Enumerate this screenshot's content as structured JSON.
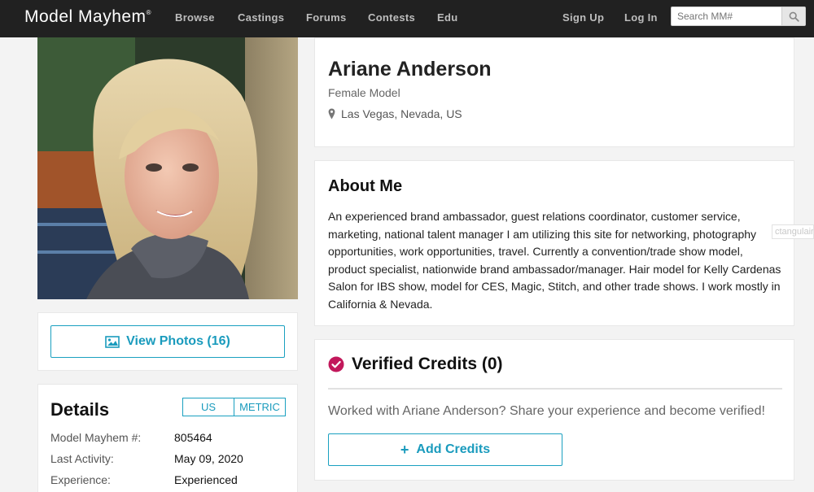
{
  "brand": {
    "logo": "Model Mayhem",
    "logo_mark": "®",
    "accent": "#1a9bbd",
    "nav_bg": "#212121",
    "verified_color": "#c2185b"
  },
  "nav": {
    "links": [
      "Browse",
      "Castings",
      "Forums",
      "Contests",
      "Edu"
    ],
    "sign_up": "Sign Up",
    "log_in": "Log In",
    "search_placeholder": "Search MM#",
    "search_icon": "search-icon"
  },
  "profile": {
    "name": "Ariane Anderson",
    "role": "Female Model",
    "location": "Las Vegas, Nevada, US",
    "photo_alt": "Profile photo"
  },
  "photos": {
    "button_label": "View Photos (16)",
    "icon": "image-icon"
  },
  "details": {
    "title": "Details",
    "units": {
      "us": "US",
      "metric": "METRIC"
    },
    "rows": [
      {
        "label": "Model Mayhem #:",
        "value": "805464"
      },
      {
        "label": "Last Activity:",
        "value": "May 09, 2020"
      },
      {
        "label": "Experience:",
        "value": "Experienced"
      }
    ]
  },
  "about": {
    "title": "About Me",
    "text": "An experienced brand ambassador, guest relations coordinator, customer service, marketing, national talent manager I am utilizing this site for networking, photography opportunities, work opportunities, travel. Currently a convention/trade show model, product specialist, nationwide brand ambassador/manager. Hair model for Kelly Cardenas Salon for IBS show, model for CES, Magic, Stitch, and other trade shows. I work mostly in California & Nevada."
  },
  "overlay": {
    "clipped_text": "ctangulair"
  },
  "credits": {
    "title": "Verified Credits (0)",
    "prompt": "Worked with Ariane Anderson? Share your experience and become verified!",
    "button_plus": "+",
    "button_label": "Add Credits"
  }
}
